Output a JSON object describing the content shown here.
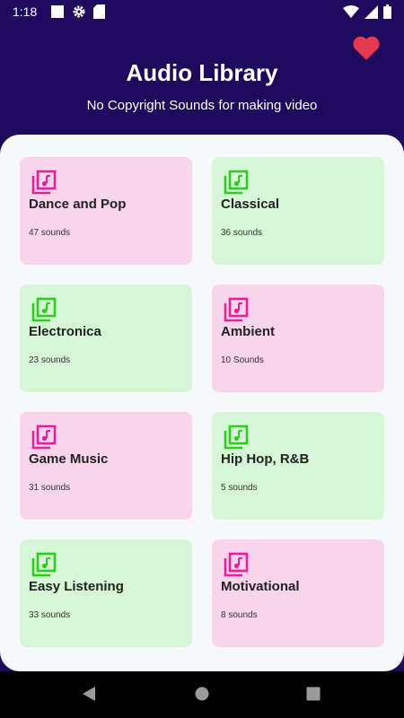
{
  "status_bar": {
    "time": "1:18",
    "left_icons": [
      "square-icon",
      "gear-icon",
      "sd-card-icon"
    ],
    "right_icons": [
      "wifi-icon",
      "signal-icon",
      "battery-icon"
    ]
  },
  "header": {
    "title": "Audio Library",
    "subtitle": "No Copyright Sounds for making video",
    "favorite_icon": "heart-icon"
  },
  "colors": {
    "header_bg": "#1e0a5c",
    "pink_card": "#f9d5ec",
    "green_card": "#d6f7d6",
    "pink_icon": "#e91e9a",
    "green_icon": "#2ecc1f",
    "heart": "#e53950"
  },
  "categories": [
    {
      "title": "Dance and Pop",
      "count": "47 sounds",
      "theme": "pink"
    },
    {
      "title": "Classical",
      "count": "36 sounds",
      "theme": "green"
    },
    {
      "title": "Electronica",
      "count": "23 sounds",
      "theme": "green"
    },
    {
      "title": "Ambient",
      "count": "10 Sounds",
      "theme": "pink"
    },
    {
      "title": "Game Music",
      "count": "31 sounds",
      "theme": "pink"
    },
    {
      "title": "Hip Hop, R&B",
      "count": "5 sounds",
      "theme": "green"
    },
    {
      "title": "Easy Listening",
      "count": "33 sounds",
      "theme": "green"
    },
    {
      "title": "Motivational",
      "count": "8 sounds",
      "theme": "pink"
    }
  ],
  "nav_bar": {
    "buttons": [
      "back-icon",
      "home-icon",
      "recents-icon"
    ]
  }
}
